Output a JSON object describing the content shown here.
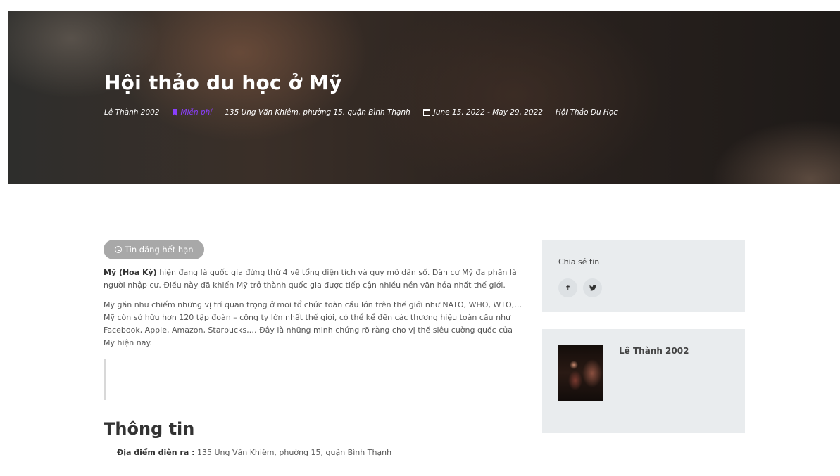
{
  "hero": {
    "title": "Hội thảo du học ở Mỹ",
    "author": "Lê Thành 2002",
    "price": "Miễn phí",
    "location": "135 Ung Văn Khiêm, phường 15, quận Bình Thạnh",
    "dates": "June 15, 2022 - May 29, 2022",
    "category": "Hội Thảo Du Học",
    "accent_color": "#8a3ffc"
  },
  "main": {
    "expired_label": "Tin đăng hết hạn",
    "para1_bold": "Mỹ (Hoa Kỳ)",
    "para1_text": " hiện đang là quốc gia đứng thứ 4 về tổng diện tích và quy mô dân số. Dân cư Mỹ đa phần là người nhập cư. Điều này đã khiến Mỹ trở thành quốc gia được tiếp cận nhiều nền văn hóa nhất thế giới.",
    "para2_text": "Mỹ gần như chiếm những vị trí quan trọng ở mọi tổ chức toàn cầu lớn trên thế giới như NATO, WHO, WTO,… Mỹ còn sở hữu hơn 120 tập đoàn – công ty lớn nhất thế giới, có thể kể đến các thương hiệu toàn cầu như Facebook, Apple, Amazon, Starbucks,… Đây là những minh chứng rõ ràng cho vị thế siêu cường quốc của  Mỹ hiện nay.",
    "section_title": "Thông tin",
    "info_label": "Địa điểm diễn ra :",
    "info_value": " 135 Ung Văn Khiêm, phường 15, quận Bình Thạnh"
  },
  "sidebar": {
    "share_title": "Chia sẻ tin",
    "facebook_glyph": "f",
    "twitter_glyph": "🐦",
    "author_name": "Lê Thành 2002"
  }
}
